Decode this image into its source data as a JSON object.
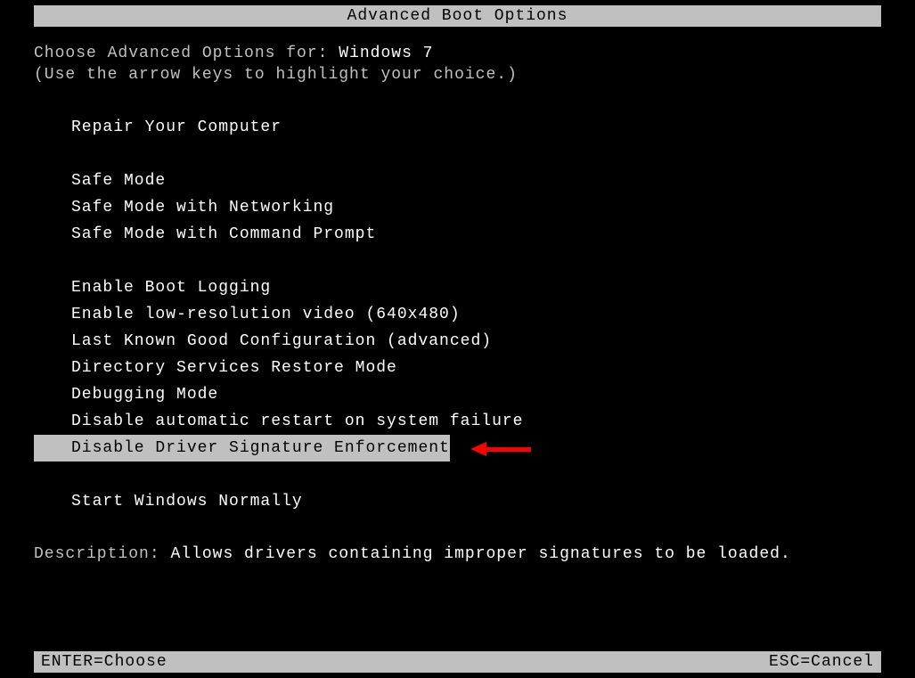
{
  "title": "Advanced Boot Options",
  "choose_prefix": "Choose Advanced Options for: ",
  "os_name": "Windows 7",
  "hint": "(Use the arrow keys to highlight your choice.)",
  "menu": {
    "group1": [
      {
        "label": "Repair Your Computer",
        "selected": false
      }
    ],
    "group2": [
      {
        "label": "Safe Mode",
        "selected": false
      },
      {
        "label": "Safe Mode with Networking",
        "selected": false
      },
      {
        "label": "Safe Mode with Command Prompt",
        "selected": false
      }
    ],
    "group3": [
      {
        "label": "Enable Boot Logging",
        "selected": false
      },
      {
        "label": "Enable low-resolution video (640x480)",
        "selected": false
      },
      {
        "label": "Last Known Good Configuration (advanced)",
        "selected": false
      },
      {
        "label": "Directory Services Restore Mode",
        "selected": false
      },
      {
        "label": "Debugging Mode",
        "selected": false
      },
      {
        "label": "Disable automatic restart on system failure",
        "selected": false
      },
      {
        "label": "Disable Driver Signature Enforcement",
        "selected": true
      }
    ],
    "group4": [
      {
        "label": "Start Windows Normally",
        "selected": false
      }
    ]
  },
  "description_label": "Description: ",
  "description_text": "Allows drivers containing improper signatures to be loaded.",
  "footer": {
    "left": "ENTER=Choose",
    "right": "ESC=Cancel"
  }
}
